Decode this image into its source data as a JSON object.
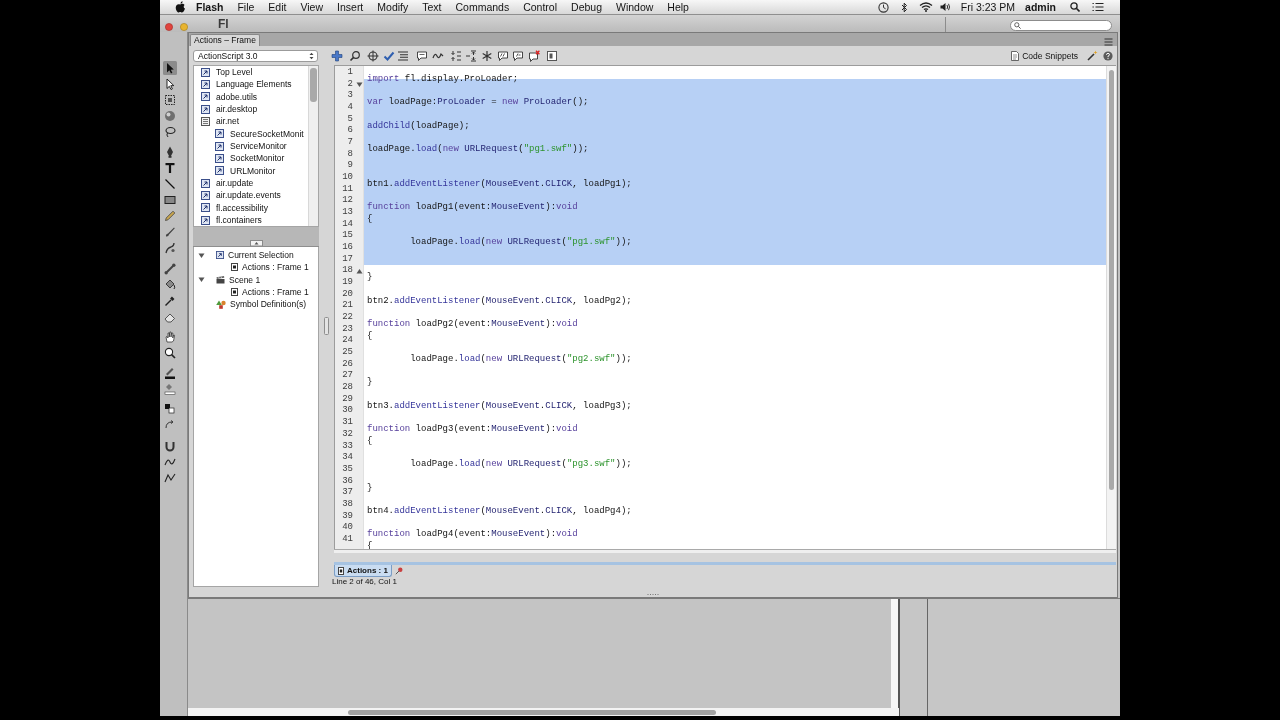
{
  "menu_bar": {
    "app_name": "Flash",
    "menus": [
      "File",
      "Edit",
      "View",
      "Insert",
      "Modify",
      "Text",
      "Commands",
      "Control",
      "Debug",
      "Window",
      "Help"
    ],
    "clock": "Fri 3:23 PM",
    "user": "admin"
  },
  "app_window": {
    "title": "Fl"
  },
  "tools": [
    {
      "selected": true
    },
    {
      "selected": false
    },
    {
      "selected": false
    },
    {
      "selected": false
    },
    {
      "selected": false
    },
    {
      "selected": false
    },
    {
      "selected": false
    },
    {
      "selected": false
    },
    {
      "selected": false
    },
    {
      "selected": false
    },
    {
      "selected": false
    },
    {
      "selected": false
    },
    {
      "selected": false
    },
    {
      "selected": false
    },
    {
      "selected": false
    },
    {
      "selected": false
    },
    {
      "selected": false
    },
    {
      "selected": false
    },
    {
      "selected": false
    },
    {
      "selected": false
    },
    {
      "selected": false
    },
    {
      "selected": false
    },
    {
      "selected": false
    },
    {
      "selected": false
    },
    {
      "selected": false
    }
  ],
  "actions_panel": {
    "tab": "Actions – Frame",
    "language": "ActionScript 3.0",
    "code_snippets": "Code Snippets",
    "toolbox": [
      {
        "label": "Top Level",
        "expanded": false
      },
      {
        "label": "Language Elements",
        "expanded": false
      },
      {
        "label": "adobe.utils",
        "expanded": false
      },
      {
        "label": "air.desktop",
        "expanded": false
      },
      {
        "label": "air.net",
        "expanded": true,
        "children": [
          {
            "label": "SecureSocketMonit",
            "expanded": false
          },
          {
            "label": "ServiceMonitor",
            "expanded": false
          },
          {
            "label": "SocketMonitor",
            "expanded": false
          },
          {
            "label": "URLMonitor",
            "expanded": false
          }
        ]
      },
      {
        "label": "air.update",
        "expanded": false
      },
      {
        "label": "air.update.events",
        "expanded": false
      },
      {
        "label": "fl.accessibility",
        "expanded": false
      },
      {
        "label": "fl.containers",
        "expanded": false
      }
    ],
    "script_navigator": [
      {
        "label": "Current Selection",
        "kind": "selection",
        "expanded": true,
        "children": [
          {
            "label": "Actions : Frame 1",
            "kind": "script"
          }
        ]
      },
      {
        "label": "Scene 1",
        "kind": "scene",
        "expanded": true,
        "children": [
          {
            "label": "Actions : Frame 1",
            "kind": "script"
          }
        ]
      },
      {
        "label": "Symbol Definition(s)",
        "kind": "symbols"
      }
    ],
    "editor": {
      "lines": [
        {
          "number": "1",
          "kind": "code",
          "selected": false,
          "tokens": [
            {
              "kind": "keyword",
              "text": "import"
            },
            {
              "kind": "plain",
              "text": " fl.display.ProLoader;"
            }
          ]
        },
        {
          "number": "2",
          "kind": "fold-start",
          "selected": true
        },
        {
          "number": "3",
          "kind": "code",
          "selected": true,
          "tokens": [
            {
              "kind": "keyword",
              "text": "var"
            },
            {
              "kind": "plain",
              "text": " loadPage:"
            },
            {
              "kind": "type",
              "text": "ProLoader"
            },
            {
              "kind": "plain",
              "text": " = "
            },
            {
              "kind": "keyword",
              "text": "new"
            },
            {
              "kind": "type",
              "text": " ProLoader"
            },
            {
              "kind": "plain",
              "text": "();"
            }
          ]
        },
        {
          "number": "4",
          "kind": "code",
          "selected": true
        },
        {
          "number": "5",
          "kind": "code",
          "selected": true,
          "tokens": [
            {
              "kind": "builtin",
              "text": "addChild"
            },
            {
              "kind": "plain",
              "text": "(loadPage);"
            }
          ]
        },
        {
          "number": "6",
          "kind": "code",
          "selected": true
        },
        {
          "number": "7",
          "kind": "code",
          "selected": true,
          "tokens": [
            {
              "kind": "plain",
              "text": "loadPage."
            },
            {
              "kind": "builtin",
              "text": "load"
            },
            {
              "kind": "plain",
              "text": "("
            },
            {
              "kind": "keyword",
              "text": "new"
            },
            {
              "kind": "type",
              "text": " URLRequest"
            },
            {
              "kind": "plain",
              "text": "("
            },
            {
              "kind": "string",
              "text": "\"pg1.swf\""
            },
            {
              "kind": "plain",
              "text": "));"
            }
          ]
        },
        {
          "number": "8",
          "kind": "code",
          "selected": true
        },
        {
          "number": "9",
          "kind": "code",
          "selected": true
        },
        {
          "number": "10",
          "kind": "code",
          "selected": true,
          "tokens": [
            {
              "kind": "plain",
              "text": "btn1."
            },
            {
              "kind": "builtin",
              "text": "addEventListener"
            },
            {
              "kind": "plain",
              "text": "("
            },
            {
              "kind": "type",
              "text": "MouseEvent"
            },
            {
              "kind": "plain",
              "text": "."
            },
            {
              "kind": "type",
              "text": "CLICK"
            },
            {
              "kind": "plain",
              "text": ", loadPg1);"
            }
          ]
        },
        {
          "number": "11",
          "kind": "code",
          "selected": true
        },
        {
          "number": "12",
          "kind": "code",
          "selected": true,
          "tokens": [
            {
              "kind": "keyword",
              "text": "function"
            },
            {
              "kind": "plain",
              "text": " loadPg1(event:"
            },
            {
              "kind": "type",
              "text": "MouseEvent"
            },
            {
              "kind": "plain",
              "text": "):"
            },
            {
              "kind": "keyword",
              "text": "void"
            }
          ]
        },
        {
          "number": "13",
          "kind": "code",
          "selected": true,
          "tokens": [
            {
              "kind": "plain",
              "text": "{"
            }
          ]
        },
        {
          "number": "14",
          "kind": "code",
          "selected": true
        },
        {
          "number": "15",
          "kind": "code",
          "selected": true,
          "tokens": [
            {
              "kind": "plain",
              "text": "\tloadPage."
            },
            {
              "kind": "builtin",
              "text": "load"
            },
            {
              "kind": "plain",
              "text": "("
            },
            {
              "kind": "keyword",
              "text": "new"
            },
            {
              "kind": "type",
              "text": " URLRequest"
            },
            {
              "kind": "plain",
              "text": "("
            },
            {
              "kind": "string",
              "text": "\"pg1.swf\""
            },
            {
              "kind": "plain",
              "text": "));"
            }
          ]
        },
        {
          "number": "16",
          "kind": "code",
          "selected": true
        },
        {
          "number": "17",
          "kind": "code",
          "selected": true
        },
        {
          "number": "18",
          "kind": "fold-end",
          "selected": false,
          "tokens": [
            {
              "kind": "plain",
              "text": "}"
            }
          ]
        },
        {
          "number": "19",
          "kind": "code",
          "selected": false
        },
        {
          "number": "20",
          "kind": "code",
          "selected": false,
          "tokens": [
            {
              "kind": "plain",
              "text": "btn2."
            },
            {
              "kind": "builtin",
              "text": "addEventListener"
            },
            {
              "kind": "plain",
              "text": "("
            },
            {
              "kind": "type",
              "text": "MouseEvent"
            },
            {
              "kind": "plain",
              "text": "."
            },
            {
              "kind": "type",
              "text": "CLICK"
            },
            {
              "kind": "plain",
              "text": ", loadPg2);"
            }
          ]
        },
        {
          "number": "21",
          "kind": "code",
          "selected": false
        },
        {
          "number": "22",
          "kind": "code",
          "selected": false,
          "tokens": [
            {
              "kind": "keyword",
              "text": "function"
            },
            {
              "kind": "plain",
              "text": " loadPg2(event:"
            },
            {
              "kind": "type",
              "text": "MouseEvent"
            },
            {
              "kind": "plain",
              "text": "):"
            },
            {
              "kind": "keyword",
              "text": "void"
            }
          ]
        },
        {
          "number": "23",
          "kind": "code",
          "selected": false,
          "tokens": [
            {
              "kind": "plain",
              "text": "{"
            }
          ]
        },
        {
          "number": "24",
          "kind": "code",
          "selected": false
        },
        {
          "number": "25",
          "kind": "code",
          "selected": false,
          "tokens": [
            {
              "kind": "plain",
              "text": "\tloadPage."
            },
            {
              "kind": "builtin",
              "text": "load"
            },
            {
              "kind": "plain",
              "text": "("
            },
            {
              "kind": "keyword",
              "text": "new"
            },
            {
              "kind": "type",
              "text": " URLRequest"
            },
            {
              "kind": "plain",
              "text": "("
            },
            {
              "kind": "string",
              "text": "\"pg2.swf\""
            },
            {
              "kind": "plain",
              "text": "));"
            }
          ]
        },
        {
          "number": "26",
          "kind": "code",
          "selected": false
        },
        {
          "number": "27",
          "kind": "code",
          "selected": false,
          "tokens": [
            {
              "kind": "plain",
              "text": "}"
            }
          ]
        },
        {
          "number": "28",
          "kind": "code",
          "selected": false
        },
        {
          "number": "29",
          "kind": "code",
          "selected": false,
          "tokens": [
            {
              "kind": "plain",
              "text": "btn3."
            },
            {
              "kind": "builtin",
              "text": "addEventListener"
            },
            {
              "kind": "plain",
              "text": "("
            },
            {
              "kind": "type",
              "text": "MouseEvent"
            },
            {
              "kind": "plain",
              "text": "."
            },
            {
              "kind": "type",
              "text": "CLICK"
            },
            {
              "kind": "plain",
              "text": ", loadPg3);"
            }
          ]
        },
        {
          "number": "30",
          "kind": "code",
          "selected": false
        },
        {
          "number": "31",
          "kind": "code",
          "selected": false,
          "tokens": [
            {
              "kind": "keyword",
              "text": "function"
            },
            {
              "kind": "plain",
              "text": " loadPg3(event:"
            },
            {
              "kind": "type",
              "text": "MouseEvent"
            },
            {
              "kind": "plain",
              "text": "):"
            },
            {
              "kind": "keyword",
              "text": "void"
            }
          ]
        },
        {
          "number": "32",
          "kind": "code",
          "selected": false,
          "tokens": [
            {
              "kind": "plain",
              "text": "{"
            }
          ]
        },
        {
          "number": "33",
          "kind": "code",
          "selected": false
        },
        {
          "number": "34",
          "kind": "code",
          "selected": false,
          "tokens": [
            {
              "kind": "plain",
              "text": "\tloadPage."
            },
            {
              "kind": "builtin",
              "text": "load"
            },
            {
              "kind": "plain",
              "text": "("
            },
            {
              "kind": "keyword",
              "text": "new"
            },
            {
              "kind": "type",
              "text": " URLRequest"
            },
            {
              "kind": "plain",
              "text": "("
            },
            {
              "kind": "string",
              "text": "\"pg3.swf\""
            },
            {
              "kind": "plain",
              "text": "));"
            }
          ]
        },
        {
          "number": "35",
          "kind": "code",
          "selected": false
        },
        {
          "number": "36",
          "kind": "code",
          "selected": false,
          "tokens": [
            {
              "kind": "plain",
              "text": "}"
            }
          ]
        },
        {
          "number": "37",
          "kind": "code",
          "selected": false
        },
        {
          "number": "38",
          "kind": "code",
          "selected": false,
          "tokens": [
            {
              "kind": "plain",
              "text": "btn4."
            },
            {
              "kind": "builtin",
              "text": "addEventListener"
            },
            {
              "kind": "plain",
              "text": "("
            },
            {
              "kind": "type",
              "text": "MouseEvent"
            },
            {
              "kind": "plain",
              "text": "."
            },
            {
              "kind": "type",
              "text": "CLICK"
            },
            {
              "kind": "plain",
              "text": ", loadPg4);"
            }
          ]
        },
        {
          "number": "39",
          "kind": "code",
          "selected": false
        },
        {
          "number": "40",
          "kind": "code",
          "selected": false,
          "tokens": [
            {
              "kind": "keyword",
              "text": "function"
            },
            {
              "kind": "plain",
              "text": " loadPg4(event:"
            },
            {
              "kind": "type",
              "text": "MouseEvent"
            },
            {
              "kind": "plain",
              "text": "):"
            },
            {
              "kind": "keyword",
              "text": "void"
            }
          ]
        },
        {
          "number": "41",
          "kind": "code",
          "selected": false,
          "tokens": [
            {
              "kind": "plain",
              "text": "{"
            }
          ]
        }
      ]
    },
    "script_tabs": [
      {
        "label": "Actions : 1",
        "selected": true
      }
    ],
    "status": "Line 2 of 46, Col 1"
  }
}
